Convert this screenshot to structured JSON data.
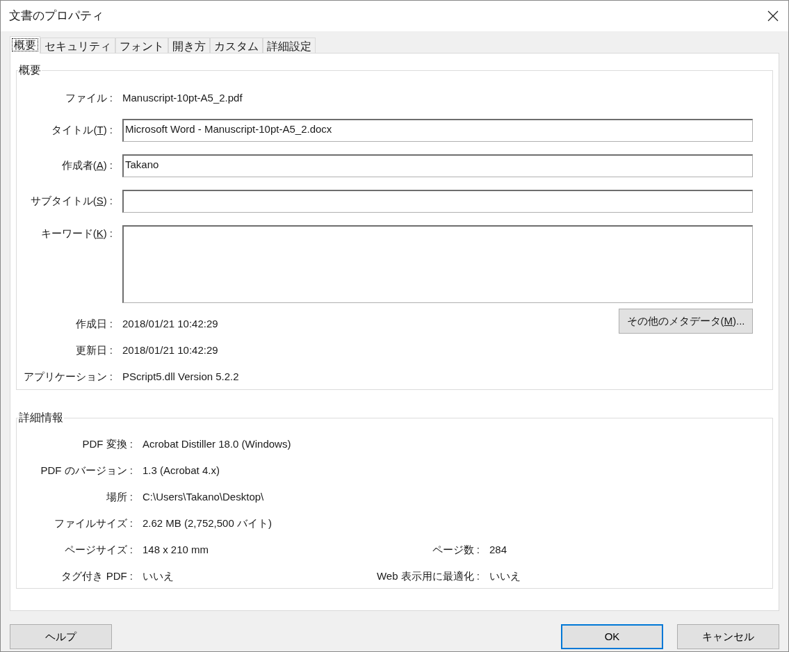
{
  "window": {
    "title": "文書のプロパティ"
  },
  "tabs": [
    {
      "label": "概要",
      "selected": true
    },
    {
      "label": "セキュリティ",
      "selected": false
    },
    {
      "label": "フォント",
      "selected": false
    },
    {
      "label": "開き方",
      "selected": false
    },
    {
      "label": "カスタム",
      "selected": false
    },
    {
      "label": "詳細設定",
      "selected": false
    }
  ],
  "summary": {
    "title": "概要",
    "file": {
      "label": "ファイル :",
      "value": "Manuscript-10pt-A5_2.pdf"
    },
    "fields": [
      {
        "kind": "text",
        "label_before": "タイトル(",
        "access_key": "T",
        "label_after": ") :",
        "value": "Microsoft Word - Manuscript-10pt-A5_2.docx"
      },
      {
        "kind": "text",
        "label_before": "作成者(",
        "access_key": "A",
        "label_after": ") :",
        "value": "Takano"
      },
      {
        "kind": "text",
        "label_before": "サブタイトル(",
        "access_key": "S",
        "label_after": ") :"
      },
      {
        "kind": "multiline",
        "label_before": "キーワード(",
        "access_key": "K",
        "label_after": ") :"
      }
    ],
    "info": [
      {
        "label": "作成日 :",
        "value": "2018/01/21 10:42:29"
      },
      {
        "label": "更新日 :",
        "value": "2018/01/21 10:42:29"
      },
      {
        "label": "アプリケーション :",
        "value": "PScript5.dll Version 5.2.2"
      }
    ],
    "metadata_button": {
      "label_before": "その他のメタデータ(",
      "access_key": "M",
      "label_after": ")..."
    }
  },
  "details": {
    "title": "詳細情報",
    "rows": [
      {
        "label": "PDF 変換 :",
        "value": "Acrobat Distiller 18.0 (Windows)"
      },
      {
        "label": "PDF のバージョン :",
        "value": "1.3 (Acrobat 4.x)"
      },
      {
        "label": "場所 :",
        "value": "C:\\Users\\Takano\\Desktop\\"
      },
      {
        "label": "ファイルサイズ :",
        "value": "2.62 MB (2,752,500 バイト)"
      },
      {
        "label": "ページサイズ :",
        "value": "148 x 210 mm",
        "label_2": "ページ数 :",
        "value_2": "284"
      },
      {
        "label": "タグ付き PDF :",
        "value": "いいえ",
        "label_2": "Web 表示用に最適化 :",
        "value_2": "いいえ"
      }
    ]
  },
  "help_button": {
    "label": "ヘルプ"
  },
  "buttons": [
    {
      "label": "OK",
      "default": true
    },
    {
      "label": "キャンセル",
      "default": false
    }
  ]
}
